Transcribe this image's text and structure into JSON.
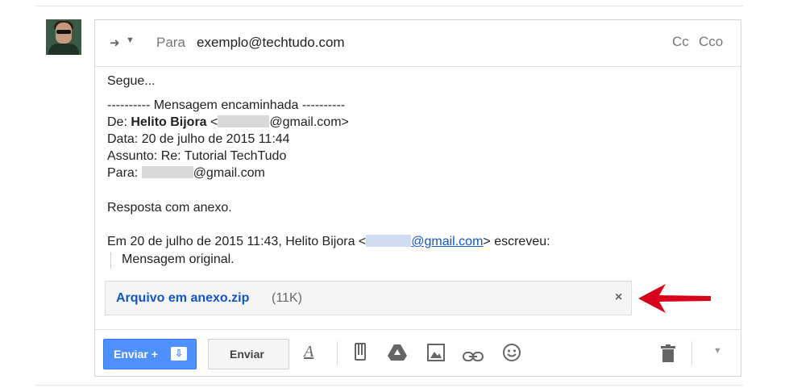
{
  "compose": {
    "to_label": "Para",
    "to_value": "exemplo@techtudo.com",
    "cc_label": "Cc",
    "cco_label": "Cco"
  },
  "message": {
    "greeting": "Segue...",
    "forward_header": "---------- Mensagem encaminhada ----------",
    "from_label": "De: ",
    "from_name": "Helito Bijora",
    "from_email_suffix": "@gmail.com>",
    "from_lt": " <",
    "date_line": "Data: 20 de julho de 2015 11:44",
    "subject_line": "Assunto: Re: Tutorial TechTudo",
    "to_label": "Para: ",
    "to_email_suffix": "@gmail.com",
    "reply_text": "Resposta com anexo.",
    "quote_intro_prefix": "Em 20 de julho de 2015 11:43, Helito Bijora <",
    "quote_intro_link": "@gmail.com",
    "quote_intro_suffix": "> escreveu:",
    "quoted_text": "Mensagem original."
  },
  "attachment": {
    "name": "Arquivo em anexo.zip",
    "size": "(11K)",
    "close": "×"
  },
  "toolbar": {
    "send_label": "Enviar +",
    "send_plain_label": "Enviar",
    "icons": [
      "format-text-icon",
      "attach-icon",
      "drive-icon",
      "photo-icon",
      "link-icon",
      "emoji-icon",
      "trash-icon",
      "more-options-icon"
    ]
  },
  "colors": {
    "send_blue": "#4d90fe",
    "link_blue": "#1155cc",
    "arrow_red": "#d9001b"
  }
}
